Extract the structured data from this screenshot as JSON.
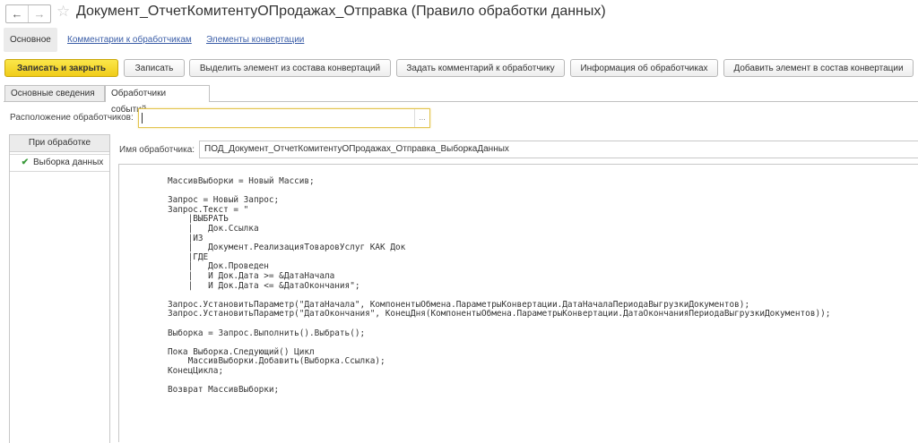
{
  "window": {
    "title": "Документ_ОтчетКомитентуОПродажах_Отправка (Правило обработки данных)",
    "nav_back": "←",
    "nav_forward": "→",
    "star_glyph": "☆"
  },
  "sections": {
    "main": "Основное",
    "comments": "Комментарии к обработчикам",
    "conversion": "Элементы конвертации"
  },
  "toolbar": {
    "save_close": "Записать и закрыть",
    "save": "Записать",
    "extract": "Выделить элемент из состава конвертаций",
    "set_comment": "Задать комментарий к обработчику",
    "info": "Информация об обработчиках",
    "add_element": "Добавить элемент в состав конвертации"
  },
  "tabs": {
    "basic": "Основные сведения",
    "events": "Обработчики событий"
  },
  "location": {
    "label": "Расположение обработчиков:",
    "value": "",
    "choose": "..."
  },
  "events_list": {
    "header": "При обработке",
    "items": [
      {
        "label": "Выборка данных",
        "check_icon": "✔",
        "check_color": "#3a9a3a"
      }
    ]
  },
  "handler": {
    "name_label": "Имя обработчика:",
    "name_value": "ПОД_Документ_ОтчетКомитентуОПродажах_Отправка_ВыборкаДанных"
  },
  "code": "МассивВыборки = Новый Массив;\n\nЗапрос = Новый Запрос;\nЗапрос.Текст = \"\n    |ВЫБРАТЬ\n    |   Док.Ссылка\n    |ИЗ\n    |   Документ.РеализацияТоваровУслуг КАК Док\n    |ГДЕ\n    |   Док.Проведен\n    |   И Док.Дата >= &ДатаНачала\n    |   И Док.Дата <= &ДатаОкончания\";\n\nЗапрос.УстановитьПараметр(\"ДатаНачала\", КомпонентыОбмена.ПараметрыКонвертации.ДатаНачалаПериодаВыгрузкиДокументов);\nЗапрос.УстановитьПараметр(\"ДатаОкончания\", КонецДня(КомпонентыОбмена.ПараметрыКонвертации.ДатаОкончанияПериодаВыгрузкиДокументов));\n\nВыборка = Запрос.Выполнить().Выбрать();\n\nПока Выборка.Следующий() Цикл\n    МассивВыборки.Добавить(Выборка.Ссылка);\nКонецЦикла;\n\nВозврат МассивВыборки;",
  "colors": {
    "accent_button": "#f0cc19",
    "link": "#3b5ea8"
  }
}
